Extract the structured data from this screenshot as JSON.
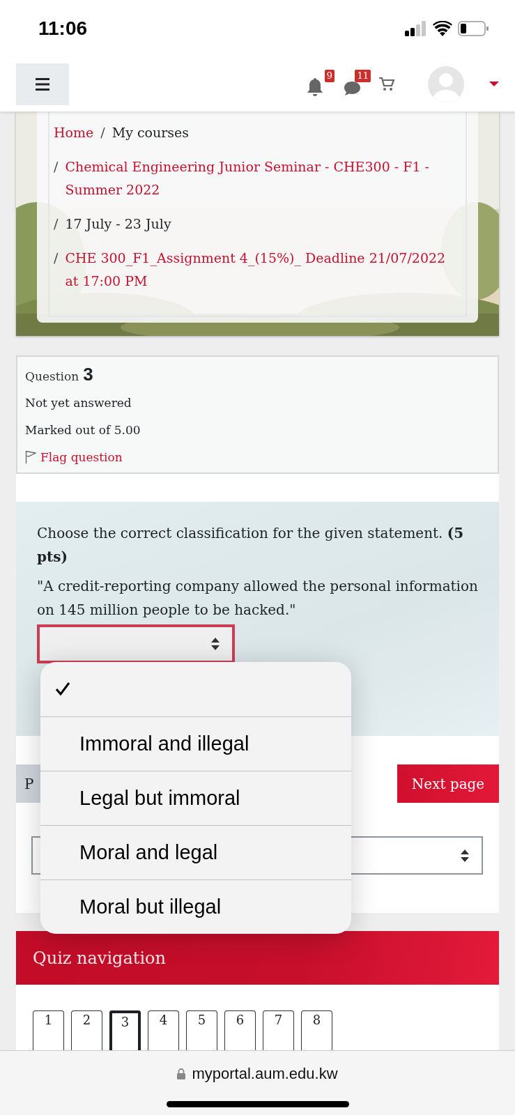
{
  "status_bar": {
    "time": "11:06"
  },
  "nav_bar": {
    "notifications": {
      "count": "9"
    },
    "messages": {
      "count": "11"
    }
  },
  "breadcrumb": [
    {
      "label": "Home",
      "link": true
    },
    {
      "separator": "/",
      "label": "My courses",
      "link": false
    },
    {
      "separator": "/",
      "label": "Chemical Engineering Junior Seminar - CHE300 - F1 - Summer 2022",
      "link": true
    },
    {
      "separator": "/",
      "label": "17 July - 23 July",
      "link": false
    },
    {
      "separator": "/",
      "label": "CHE 300_F1_Assignment 4_(15%)_ Deadline 21/07/2022 at 17:00 PM",
      "link": true
    }
  ],
  "question_info": {
    "label": "Question",
    "number": "3",
    "status": "Not yet answered",
    "marks": "Marked out of 5.00",
    "flag": "Flag question"
  },
  "question": {
    "prompt": "Choose the correct classification for the given statement. **(5 pts)**",
    "statement": "\"A credit-reporting company allowed the personal information on 145 million people to be hacked.\""
  },
  "navigation_buttons": {
    "previous": "P",
    "next": "Next page"
  },
  "dropdown": {
    "options": [
      {
        "checked": true
      },
      {
        "label": "Immoral and illegal",
        "checked": false
      },
      {
        "label": "Legal but immoral",
        "checked": false
      },
      {
        "label": "Moral and legal",
        "checked": false
      },
      {
        "label": "Moral but illegal",
        "checked": false
      }
    ]
  },
  "quiz_navigation": {
    "title": "Quiz navigation",
    "pages": [
      {
        "label": "1",
        "selected": false
      },
      {
        "label": "2",
        "selected": false
      },
      {
        "label": "3",
        "selected": true
      },
      {
        "label": "4",
        "selected": false
      },
      {
        "label": "5",
        "selected": false
      },
      {
        "label": "6",
        "selected": false
      },
      {
        "label": "7",
        "selected": false
      },
      {
        "label": "8",
        "selected": false
      }
    ]
  },
  "url_bar": {
    "address": "myportal.aum.edu.kw"
  }
}
